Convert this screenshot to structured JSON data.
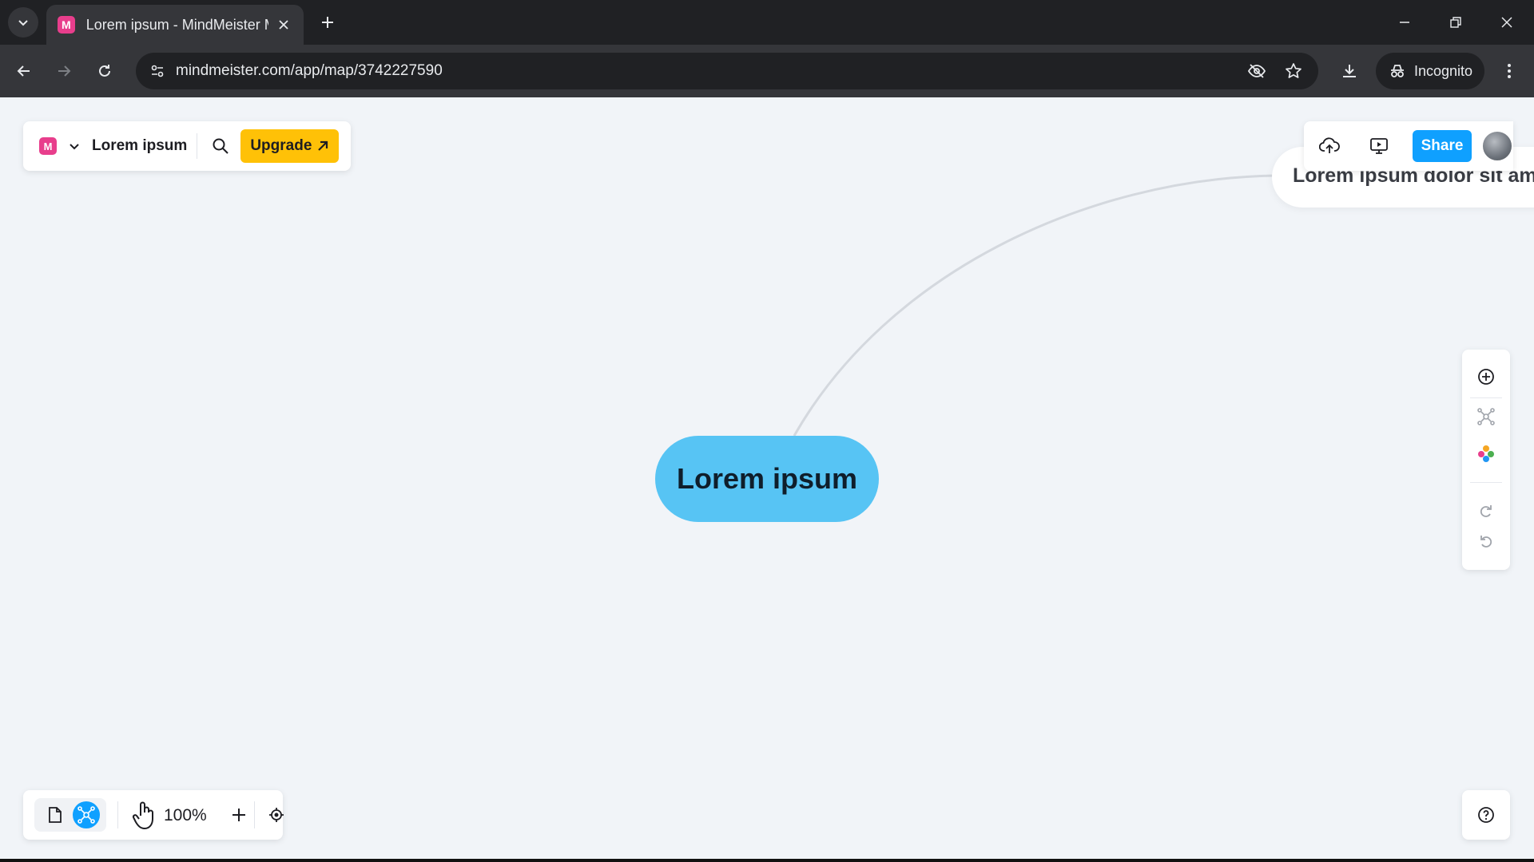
{
  "browser": {
    "tab_title": "Lorem ipsum - MindMeister Mi",
    "tab_favicon_letter": "M",
    "url": "mindmeister.com/app/map/3742227590",
    "incognito_label": "Incognito",
    "icons": {
      "tab_list": "chevron-down-icon",
      "close_tab": "close-icon",
      "new_tab": "plus-icon",
      "back": "arrow-left-icon",
      "forward": "arrow-right-icon",
      "reload": "reload-icon",
      "site_info": "tune-icon",
      "tracking": "eye-off-icon",
      "bookmark": "star-icon",
      "download": "download-icon",
      "menu": "kebab-menu-icon"
    }
  },
  "app": {
    "logo_letter": "M",
    "map_title": "Lorem ipsum",
    "upgrade_label": "Upgrade",
    "share_label": "Share",
    "root_topic": "Lorem ipsum",
    "child_topic": "Lorem ipsum dolor sit am",
    "zoom_level": "100%",
    "colors": {
      "canvas_bg": "#f1f4f8",
      "root_node": "#57c4f4",
      "upgrade": "#ffc107",
      "share": "#0fa0ff",
      "brand": "#e83e8c"
    },
    "side_tools": [
      "add-topic-icon",
      "connect-icon",
      "style-palette-icon",
      "redo-icon",
      "undo-icon"
    ],
    "bottom_tools": [
      "outline-view-icon",
      "mind-map-view-icon",
      "hand-pan-icon",
      "zoom-in-icon",
      "center-map-icon"
    ]
  }
}
